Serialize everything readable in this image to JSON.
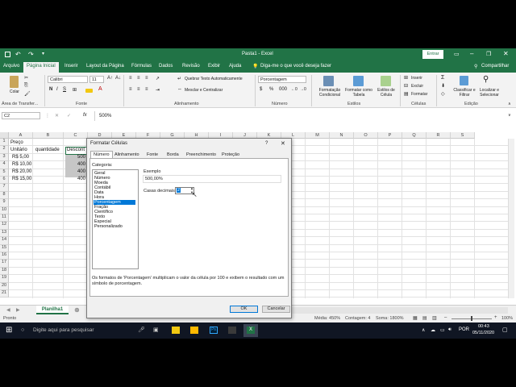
{
  "window": {
    "title": "Pasta1 - Excel",
    "signin": "Entrar",
    "qa_save_icon": "save-icon",
    "qa_undo_icon": "undo-icon",
    "qa_redo_icon": "redo-icon"
  },
  "ribbon_tabs": [
    "Arquivo",
    "Página Inicial",
    "Inserir",
    "Layout da Página",
    "Fórmulas",
    "Dados",
    "Revisão",
    "Exibir",
    "Ajuda"
  ],
  "tell_me": "Diga-me o que você deseja fazer",
  "share": "Compartilhar",
  "clipboard": {
    "paste": "Colar",
    "label": "Área de Transfer..."
  },
  "font": {
    "name": "Calibri",
    "size": "11",
    "bold": "N",
    "italic": "I",
    "underline": "S",
    "label": "Fonte"
  },
  "alignment": {
    "wrap": "Quebrar Texto Automaticamente",
    "merge": "Mesclar e Centralizar",
    "label": "Alinhamento"
  },
  "number": {
    "format": "Porcentagem",
    "label": "Número"
  },
  "styles": {
    "conditional": "Formatação Condicional",
    "as_table": "Formatar como Tabela",
    "cell_styles": "Estilos de Célula",
    "label": "Estilos"
  },
  "cells": {
    "insert": "Inserir",
    "delete": "Excluir",
    "format": "Formatar",
    "label": "Células"
  },
  "editing": {
    "sort": "Classificar e Filtrar",
    "find": "Localizar e Selecionar",
    "label": "Edição"
  },
  "formula_bar": {
    "name_box": "C2",
    "fx": "fx",
    "value": "500%"
  },
  "columns": [
    "A",
    "B",
    "C",
    "D",
    "E",
    "F",
    "G",
    "H",
    "I",
    "J",
    "K",
    "L",
    "M",
    "N",
    "O",
    "P",
    "Q",
    "R",
    "S"
  ],
  "rows": [
    "1",
    "2",
    "3",
    "4",
    "5",
    "6",
    "7",
    "8",
    "9",
    "10",
    "11",
    "12",
    "13",
    "14",
    "15",
    "16",
    "17",
    "18",
    "19",
    "20",
    "21"
  ],
  "cells_data": {
    "a0": "Preço",
    "a1": "Unitário",
    "b1": "quantidade",
    "c1": "Descont",
    "a2": "R$   5,00",
    "a3": "R$ 10,00",
    "a4": "R$ 20,00",
    "a5": "R$ 15,00",
    "c2": "500",
    "c3": "400",
    "c4": "400",
    "c5": "400"
  },
  "sheet_tab": "Planilha1",
  "status": {
    "ready": "Pronto",
    "average": "Média: 450%",
    "count": "Contagem: 4",
    "sum": "Soma: 1800%",
    "zoom": "100%"
  },
  "taskbar": {
    "search_placeholder": "Digite aqui para pesquisar",
    "time": "00:43",
    "date": "05/11/2020",
    "lang": "POR"
  },
  "dialog": {
    "title": "Formatar Células",
    "help": "?",
    "tabs": [
      "Número",
      "Alinhamento",
      "Fonte",
      "Borda",
      "Preenchimento",
      "Proteção"
    ],
    "category_label": "Categoria:",
    "categories": [
      "Geral",
      "Número",
      "Moeda",
      "Contábil",
      "Data",
      "Hora",
      "Porcentagem",
      "Fração",
      "Científico",
      "Texto",
      "Especial",
      "Personalizado"
    ],
    "selected_category": "Porcentagem",
    "example_label": "Exemplo",
    "example_value": "500,00%",
    "decimals_label": "Casas decimais:",
    "decimals_value": "2",
    "description": "Os formatos de 'Porcentagem' multiplicam o valor da célula por 100 e exibem o resultado com um símbolo de porcentagem.",
    "ok": "OK",
    "cancel": "Cancelar"
  }
}
